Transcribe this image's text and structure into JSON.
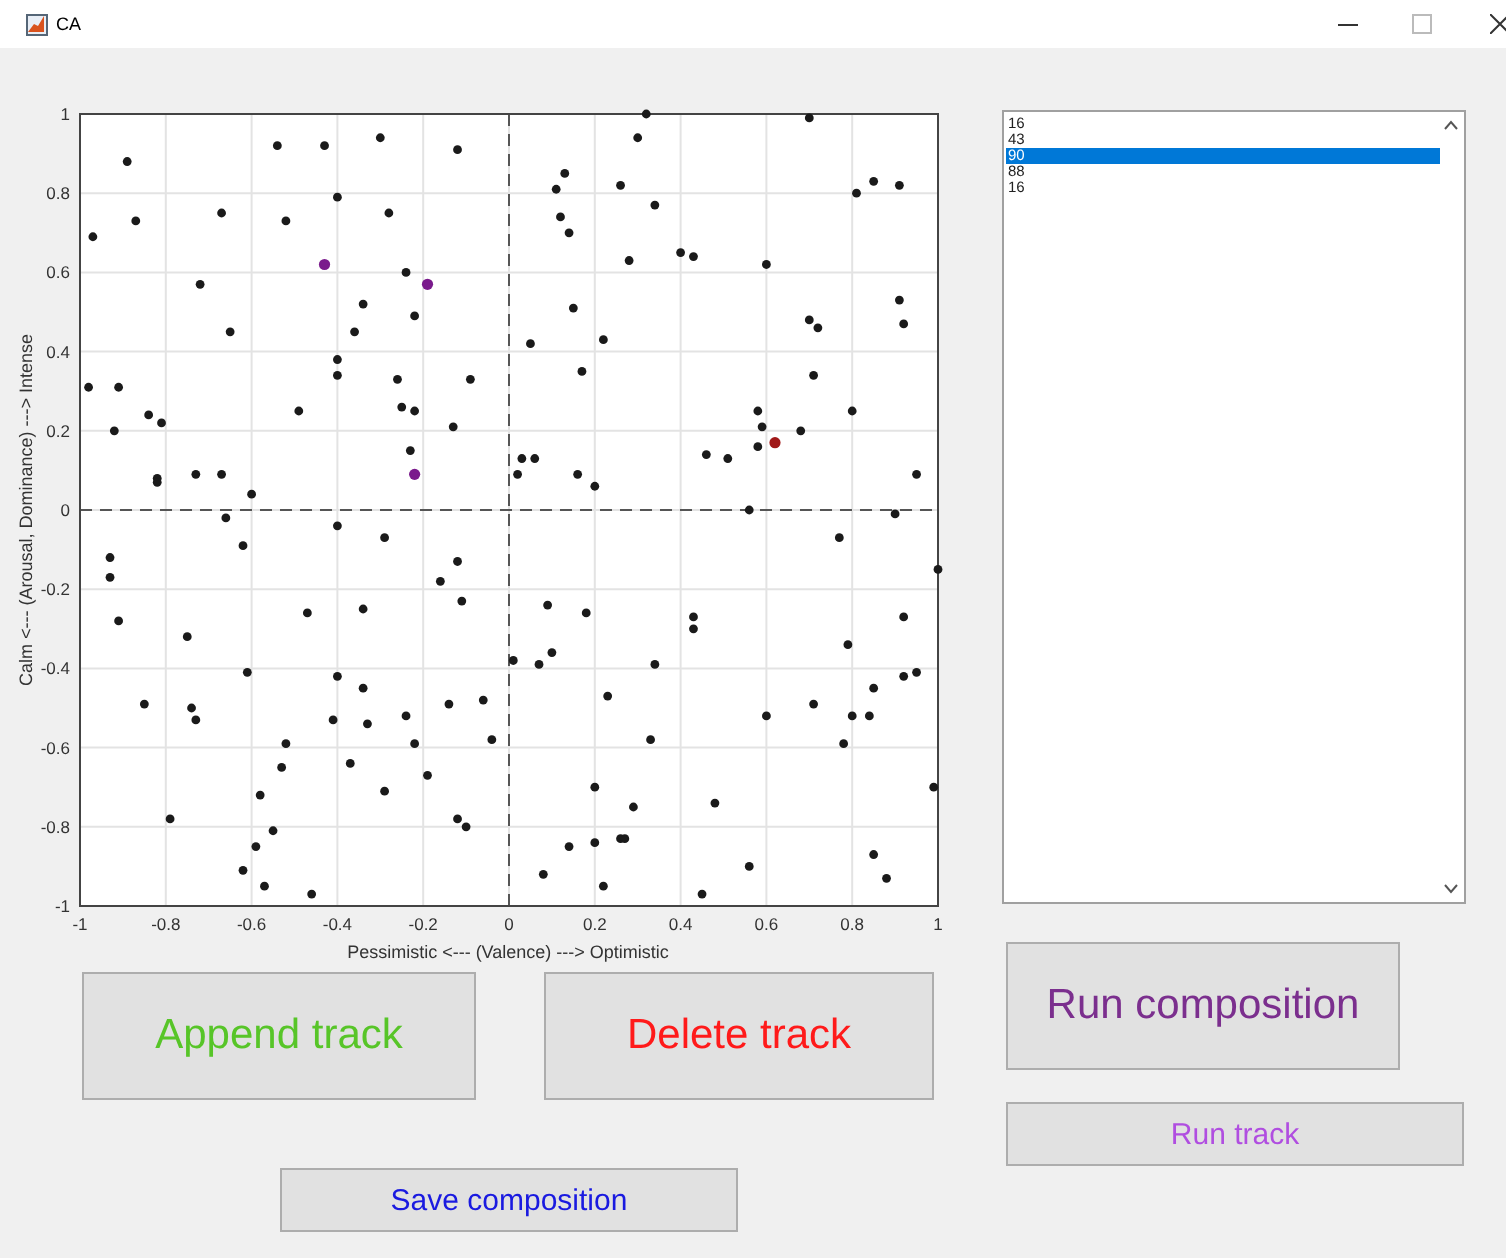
{
  "window": {
    "title": "CA"
  },
  "plot": {
    "chart_data": {
      "type": "scatter",
      "xlabel": "Pessimistic <--- (Valence) ---> Optimistic",
      "ylabel": "Calm <--- (Arousal, Dominance) ---> Intense",
      "xlim": [
        -1,
        1
      ],
      "ylim": [
        -1,
        1
      ],
      "grid": true,
      "xticks": [
        -1,
        -0.8,
        -0.6,
        -0.4,
        -0.2,
        0,
        0.2,
        0.4,
        0.6,
        0.8,
        1
      ],
      "yticks": [
        -1,
        -0.8,
        -0.6,
        -0.4,
        -0.2,
        0,
        0.2,
        0.4,
        0.6,
        0.8,
        1
      ],
      "series": [
        {
          "color": "#1a1a1a",
          "x": [
            -0.98,
            -0.97,
            -0.89,
            -0.87,
            -0.92,
            -0.91,
            -0.84,
            -0.81,
            -0.82,
            -0.82,
            -0.73,
            -0.72,
            -0.67,
            -0.67,
            -0.65,
            -0.6,
            -0.54,
            -0.52,
            -0.49,
            -0.43,
            -0.4,
            -0.4,
            -0.4,
            -0.36,
            -0.34,
            -0.3,
            -0.28,
            -0.24,
            -0.26,
            -0.25,
            -0.22,
            -0.22,
            -0.23,
            -0.13,
            -0.12,
            -0.09,
            0.32,
            0.7,
            0.3,
            0.13,
            0.11,
            0.26,
            0.12,
            0.14,
            0.34,
            0.28,
            0.4,
            0.43,
            0.6,
            0.81,
            0.85,
            0.91,
            0.15,
            0.05,
            0.22,
            0.17,
            0.7,
            0.72,
            0.91,
            0.92,
            0.71,
            0.58,
            0.59,
            0.58,
            0.68,
            0.8,
            0.46,
            0.51,
            0.03,
            0.06,
            0.02,
            0.16,
            0.2,
            0.95,
            0.56,
            0.9,
            -0.66,
            -0.62,
            -0.4,
            -0.29,
            -0.93,
            -0.93,
            -0.91,
            -0.75,
            -0.47,
            -0.34,
            -0.61,
            -0.85,
            -0.74,
            -0.73,
            -0.4,
            -0.34,
            -0.41,
            -0.33,
            -0.24,
            -0.52,
            -0.53,
            -0.58,
            -0.37,
            -0.22,
            -0.19,
            -0.29,
            -0.16,
            -0.12,
            -0.11,
            -0.14,
            -0.06,
            -0.04,
            0.01,
            -0.79,
            -0.55,
            -0.59,
            -0.62,
            -0.57,
            -0.46,
            -0.12,
            -0.1,
            0.77,
            1.0,
            0.09,
            0.18,
            0.43,
            0.43,
            0.1,
            0.07,
            0.34,
            0.79,
            0.92,
            0.23,
            0.6,
            0.71,
            0.8,
            0.84,
            0.85,
            0.92,
            0.95,
            0.78,
            0.33,
            0.2,
            0.29,
            0.48,
            0.99,
            0.14,
            0.2,
            0.26,
            0.27,
            0.08,
            0.22,
            0.45,
            0.56,
            0.85,
            0.88
          ],
          "values": [
            0.31,
            0.69,
            0.88,
            0.73,
            0.2,
            0.31,
            0.24,
            0.22,
            0.08,
            0.07,
            0.09,
            0.57,
            0.75,
            0.09,
            0.45,
            0.04,
            0.92,
            0.73,
            0.25,
            0.92,
            0.79,
            0.38,
            0.34,
            0.45,
            0.52,
            0.94,
            0.75,
            0.6,
            0.33,
            0.26,
            0.49,
            0.25,
            0.15,
            0.21,
            0.91,
            0.33,
            1.0,
            0.99,
            0.94,
            0.85,
            0.81,
            0.82,
            0.74,
            0.7,
            0.77,
            0.63,
            0.65,
            0.64,
            0.62,
            0.8,
            0.83,
            0.82,
            0.51,
            0.42,
            0.43,
            0.35,
            0.48,
            0.46,
            0.53,
            0.47,
            0.34,
            0.25,
            0.21,
            0.16,
            0.2,
            0.25,
            0.14,
            0.13,
            0.13,
            0.13,
            0.09,
            0.09,
            0.06,
            0.09,
            0.0,
            -0.01,
            -0.02,
            -0.09,
            -0.04,
            -0.07,
            -0.12,
            -0.17,
            -0.28,
            -0.32,
            -0.26,
            -0.25,
            -0.41,
            -0.49,
            -0.5,
            -0.53,
            -0.42,
            -0.45,
            -0.53,
            -0.54,
            -0.52,
            -0.59,
            -0.65,
            -0.72,
            -0.64,
            -0.59,
            -0.67,
            -0.71,
            -0.18,
            -0.13,
            -0.23,
            -0.49,
            -0.48,
            -0.58,
            -0.38,
            -0.78,
            -0.81,
            -0.85,
            -0.91,
            -0.95,
            -0.97,
            -0.78,
            -0.8,
            -0.07,
            -0.15,
            -0.24,
            -0.26,
            -0.27,
            -0.3,
            -0.36,
            -0.39,
            -0.39,
            -0.34,
            -0.27,
            -0.47,
            -0.52,
            -0.49,
            -0.52,
            -0.52,
            -0.45,
            -0.42,
            -0.41,
            -0.59,
            -0.58,
            -0.7,
            -0.75,
            -0.74,
            -0.7,
            -0.85,
            -0.84,
            -0.83,
            -0.83,
            -0.92,
            -0.95,
            -0.97,
            -0.9,
            -0.87,
            -0.93
          ]
        },
        {
          "color": "#7a1a8c",
          "x": [
            -0.43,
            -0.19,
            -0.22
          ],
          "values": [
            0.62,
            0.57,
            0.09
          ]
        },
        {
          "color": "#a01818",
          "x": [
            0.62
          ],
          "values": [
            0.17
          ]
        }
      ]
    }
  },
  "list": {
    "items": [
      {
        "label": "16",
        "selected": false
      },
      {
        "label": "43",
        "selected": false
      },
      {
        "label": "90",
        "selected": true
      },
      {
        "label": "88",
        "selected": false
      },
      {
        "label": "16",
        "selected": false
      }
    ]
  },
  "buttons": [
    {
      "label": "Append track",
      "color": "#57c528",
      "kind": "large"
    },
    {
      "label": "Delete track",
      "color": "#ff1a1a",
      "kind": "large"
    },
    {
      "label": "Run composition",
      "color": "#7b2f8e",
      "kind": "large"
    },
    {
      "label": "Run track",
      "color": "#b04ee0",
      "kind": "small"
    },
    {
      "label": "Save composition",
      "color": "#1a1ae0",
      "kind": "small"
    }
  ]
}
